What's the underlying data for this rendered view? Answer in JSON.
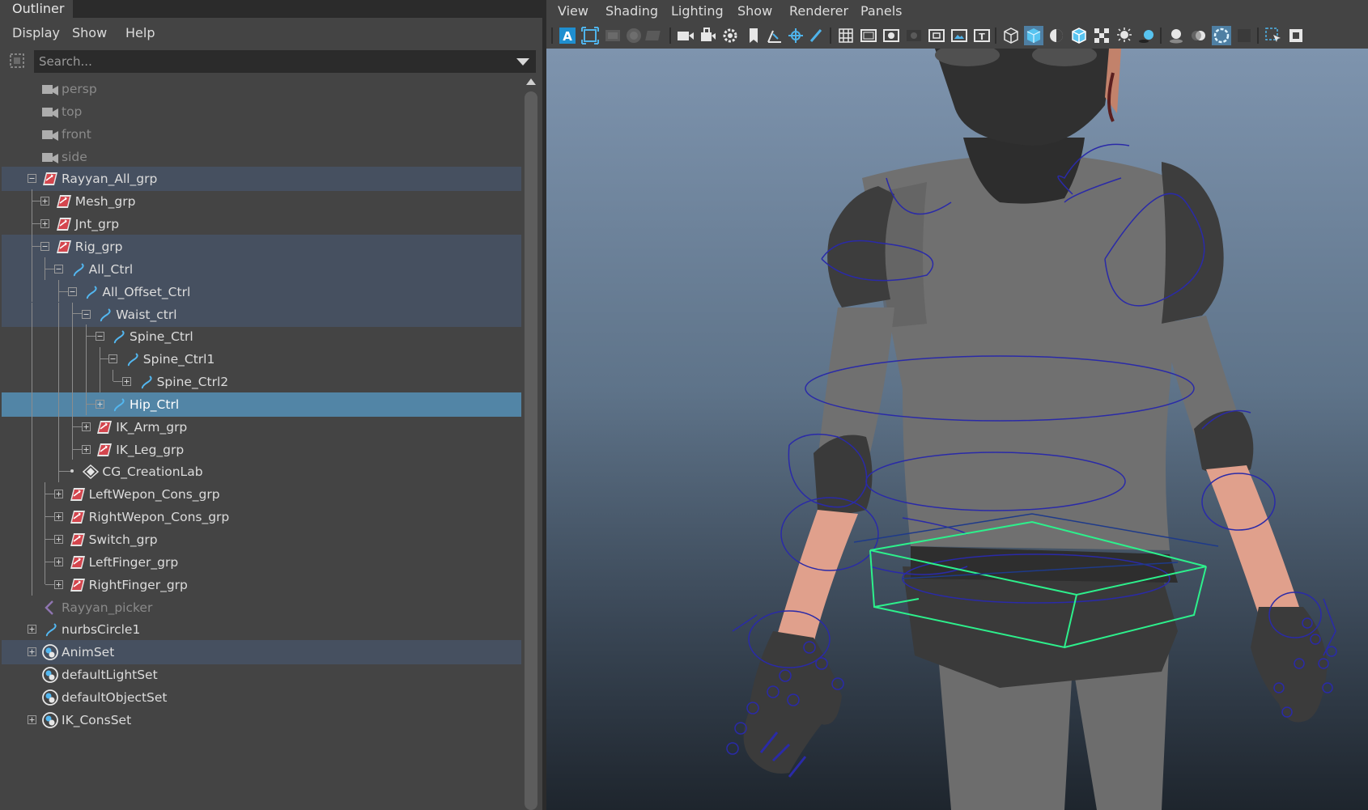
{
  "outliner": {
    "tab_title": "Outliner",
    "menu": [
      "Display",
      "Show",
      "Help"
    ],
    "search_placeholder": "Search...",
    "rows": [
      {
        "label": "persp",
        "depth": 0,
        "icon": "camera-icon",
        "expander": "none",
        "state": "dim"
      },
      {
        "label": "top",
        "depth": 0,
        "icon": "camera-icon",
        "expander": "none",
        "state": "dim"
      },
      {
        "label": "front",
        "depth": 0,
        "icon": "camera-icon",
        "expander": "none",
        "state": "dim"
      },
      {
        "label": "side",
        "depth": 0,
        "icon": "camera-icon",
        "expander": "none",
        "state": "dim"
      },
      {
        "label": "Rayyan_All_grp",
        "depth": 0,
        "icon": "transform-group-icon",
        "expander": "minus",
        "state": "highlight"
      },
      {
        "label": "Mesh_grp",
        "depth": 1,
        "icon": "transform-group-icon",
        "expander": "plus",
        "state": "normal"
      },
      {
        "label": "Jnt_grp",
        "depth": 1,
        "icon": "transform-group-icon",
        "expander": "plus",
        "state": "normal"
      },
      {
        "label": "Rig_grp",
        "depth": 1,
        "icon": "transform-group-icon",
        "expander": "minus",
        "state": "highlight"
      },
      {
        "label": "All_Ctrl",
        "depth": 2,
        "icon": "nurbs-curve-icon",
        "expander": "minus",
        "state": "highlight"
      },
      {
        "label": "All_Offset_Ctrl",
        "depth": 3,
        "icon": "nurbs-curve-icon",
        "expander": "minus",
        "state": "highlight"
      },
      {
        "label": "Waist_ctrl",
        "depth": 4,
        "icon": "nurbs-curve-icon",
        "expander": "minus",
        "state": "highlight"
      },
      {
        "label": "Spine_Ctrl",
        "depth": 5,
        "icon": "nurbs-curve-icon",
        "expander": "minus",
        "state": "normal"
      },
      {
        "label": "Spine_Ctrl1",
        "depth": 6,
        "icon": "nurbs-curve-icon",
        "expander": "minus",
        "state": "normal"
      },
      {
        "label": "Spine_Ctrl2",
        "depth": 7,
        "icon": "nurbs-curve-icon",
        "expander": "plus",
        "state": "normal"
      },
      {
        "label": "Hip_Ctrl",
        "depth": 5,
        "icon": "nurbs-curve-icon",
        "expander": "plus",
        "state": "selected"
      },
      {
        "label": "IK_Arm_grp",
        "depth": 4,
        "icon": "transform-group-icon",
        "expander": "plus",
        "state": "normal"
      },
      {
        "label": "IK_Leg_grp",
        "depth": 4,
        "icon": "transform-group-icon",
        "expander": "plus",
        "state": "normal"
      },
      {
        "label": "CG_CreationLab",
        "depth": 3,
        "icon": "locator-icon",
        "expander": "dot",
        "state": "normal"
      },
      {
        "label": "LeftWepon_Cons_grp",
        "depth": 2,
        "icon": "transform-group-icon",
        "expander": "plus",
        "state": "normal"
      },
      {
        "label": "RightWepon_Cons_grp",
        "depth": 2,
        "icon": "transform-group-icon",
        "expander": "plus",
        "state": "normal"
      },
      {
        "label": "Switch_grp",
        "depth": 2,
        "icon": "transform-group-icon",
        "expander": "plus",
        "state": "normal"
      },
      {
        "label": "LeftFinger_grp",
        "depth": 2,
        "icon": "transform-group-icon",
        "expander": "plus",
        "state": "normal"
      },
      {
        "label": "RightFinger_grp",
        "depth": 2,
        "icon": "transform-group-icon",
        "expander": "plus",
        "state": "normal"
      },
      {
        "label": "Rayyan_picker",
        "depth": 0,
        "icon": "picker-icon",
        "expander": "none",
        "state": "dim"
      },
      {
        "label": "nurbsCircle1",
        "depth": 0,
        "icon": "nurbs-curve-icon",
        "expander": "plus",
        "state": "normal"
      },
      {
        "label": "AnimSet",
        "depth": 0,
        "icon": "set-icon",
        "expander": "plus",
        "state": "highlight"
      },
      {
        "label": "defaultLightSet",
        "depth": 0,
        "icon": "set-icon",
        "expander": "none",
        "state": "normal"
      },
      {
        "label": "defaultObjectSet",
        "depth": 0,
        "icon": "set-icon",
        "expander": "none",
        "state": "normal"
      },
      {
        "label": "IK_ConsSet",
        "depth": 0,
        "icon": "set-icon",
        "expander": "plus",
        "state": "normal"
      }
    ]
  },
  "viewport": {
    "menu": [
      "View",
      "Shading",
      "Lighting",
      "Show",
      "Renderer",
      "Panels"
    ]
  },
  "colors": {
    "panel_bg": "#444444",
    "dark_bg": "#2b2b2b",
    "selected_row": "#5285a6",
    "highlight_row": "#465060",
    "curve_blue": "#2a2aa8",
    "selection_green": "#2df08c"
  }
}
